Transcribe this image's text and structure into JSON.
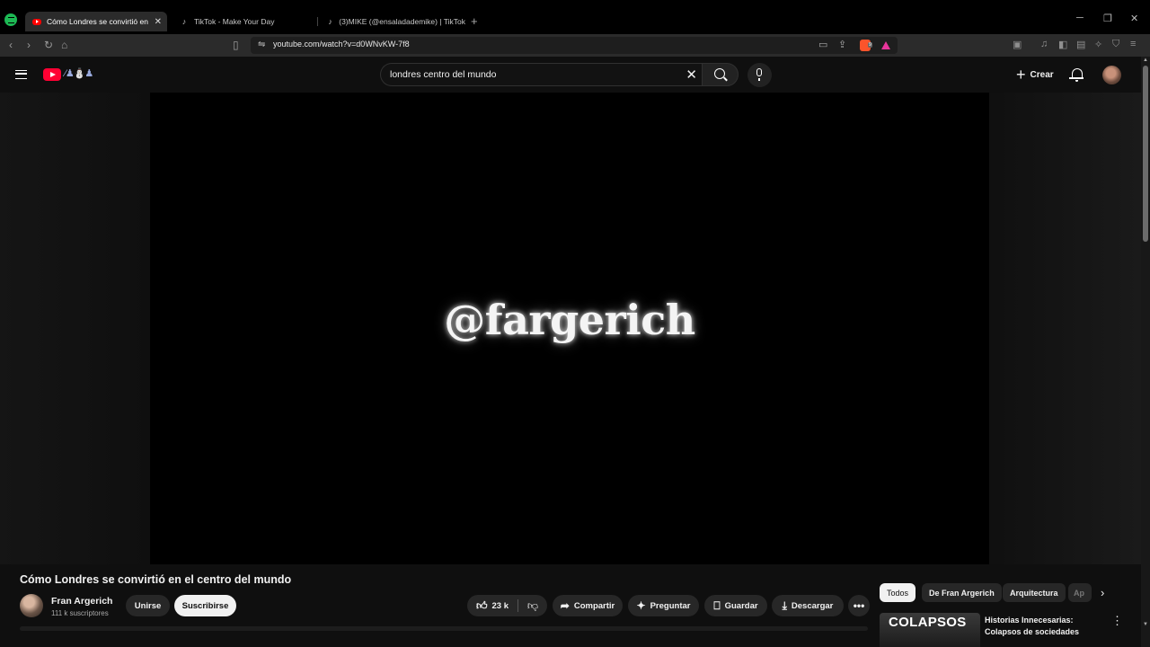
{
  "browser": {
    "tabs": [
      {
        "title": "Cómo Londres se convirtió en el",
        "active": true
      },
      {
        "title": "TikTok - Make Your Day",
        "active": false
      },
      {
        "title": "(3)MIKE (@ensaladademike) | TikTok",
        "active": false
      }
    ],
    "url": "youtube.com/watch?v=d0WNvKW-7f8",
    "extension_badge": "9"
  },
  "header": {
    "search_query": "londres centro del mundo",
    "create_label": "Crear"
  },
  "player": {
    "watermark_text": "@fargerich"
  },
  "video": {
    "title": "Cómo Londres se convirtió en el centro del mundo",
    "channel_name": "Fran Argerich",
    "subscribers": "111 k suscriptores",
    "join_label": "Unirse",
    "subscribe_label": "Suscribirse",
    "like_count": "23 k",
    "share_label": "Compartir",
    "ask_label": "Preguntar",
    "save_label": "Guardar",
    "download_label": "Descargar"
  },
  "related": {
    "chips": [
      "Todos",
      "De Fran Argerich",
      "Arquitectura",
      "Ap"
    ],
    "items": [
      {
        "thumb_text": "COLAPSOS",
        "title": "Historias Innecesarias: Colapsos de sociedades"
      }
    ]
  },
  "colors": {
    "background": "#0f0f0f",
    "youtube_red": "#ff0033",
    "chip_bg": "#272727",
    "text": "#f1f1f1"
  }
}
